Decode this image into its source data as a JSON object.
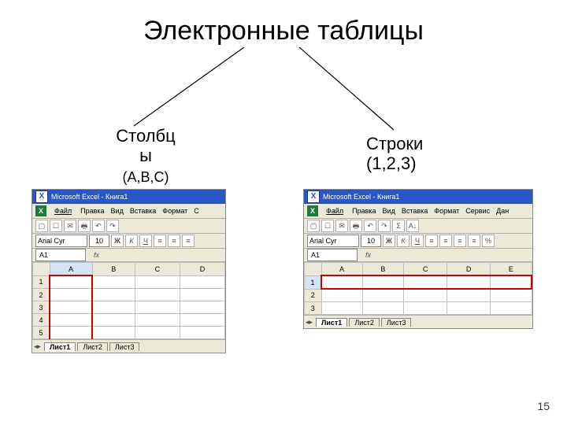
{
  "title": "Электронные таблицы",
  "page_number": "15",
  "left": {
    "label_line1": "Столбц",
    "label_line2": "ы",
    "label_small": "(A,B,C)",
    "titlebar": "Microsoft Excel - Книга1",
    "menu": [
      "Файл",
      "Правка",
      "Вид",
      "Вставка",
      "Формат",
      "С"
    ],
    "font": "Arial Cyr",
    "fontsize": "10",
    "namebox": "A1",
    "fx_label": "fx",
    "col_headers": [
      "A",
      "B",
      "C",
      "D"
    ],
    "row_headers": [
      "1",
      "2",
      "3",
      "4",
      "5"
    ],
    "tabs": [
      "Лист1",
      "Лист2",
      "Лист3"
    ],
    "icons": [
      "▢",
      "☐",
      "✉",
      "🖶",
      "↶",
      "↷"
    ],
    "style_icons": [
      "Ж",
      "К",
      "Ч",
      "≡",
      "≡",
      "≡"
    ]
  },
  "right": {
    "label_line1": "Строки",
    "label_small": "(1,2,3)",
    "titlebar": "Microsoft Excel - Книга1",
    "menu": [
      "Файл",
      "Правка",
      "Вид",
      "Вставка",
      "Формат",
      "Сервис",
      "Дан"
    ],
    "font": "Arial Cyr",
    "fontsize": "10",
    "namebox": "A1",
    "fx_label": "fx",
    "col_headers": [
      "A",
      "B",
      "C",
      "D",
      "E"
    ],
    "row_headers": [
      "1",
      "2",
      "3"
    ],
    "tabs": [
      "Лист1",
      "Лист2",
      "Лист3"
    ],
    "icons": [
      "▢",
      "☐",
      "✉",
      "🖶",
      "↶",
      "↷",
      "Σ",
      "A↓"
    ],
    "style_icons": [
      "Ж",
      "К",
      "Ч",
      "≡",
      "≡",
      "≡",
      "≡",
      "%"
    ]
  }
}
